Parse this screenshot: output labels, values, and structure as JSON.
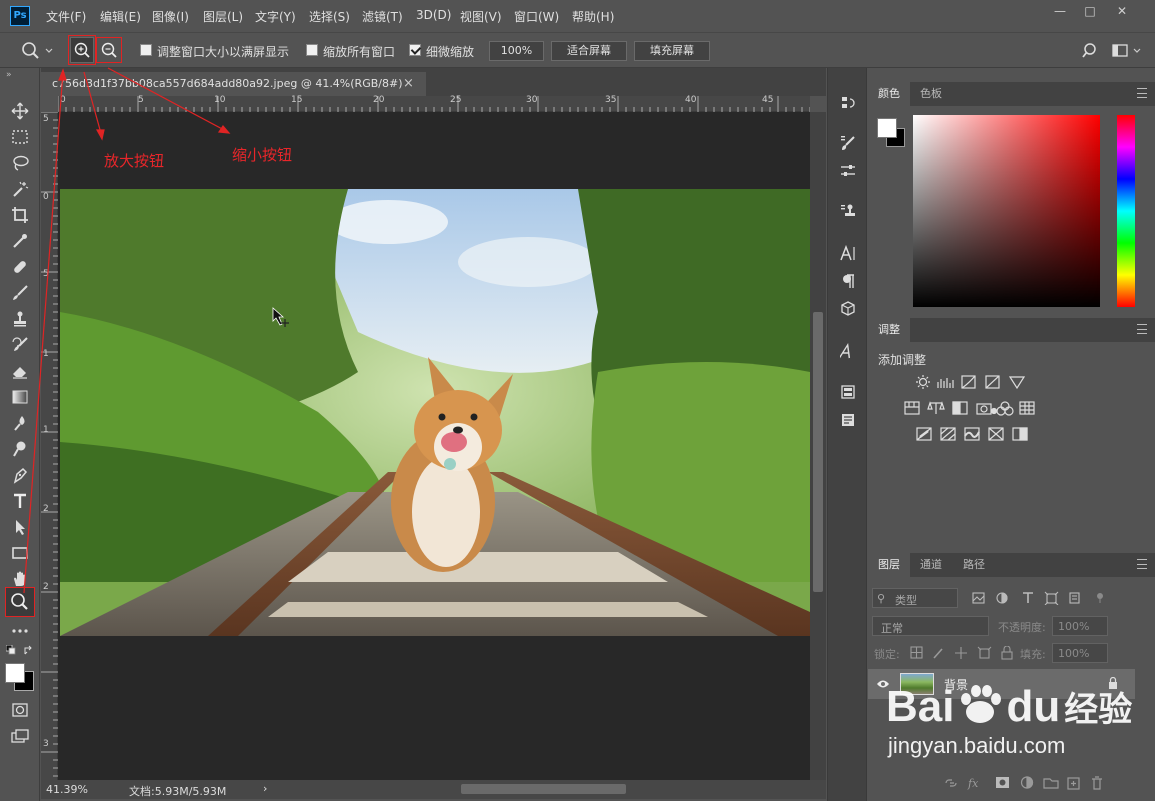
{
  "app": {
    "logo": "Ps"
  },
  "menu": {
    "items": [
      "文件(F)",
      "编辑(E)",
      "图像(I)",
      "图层(L)",
      "文字(Y)",
      "选择(S)",
      "滤镜(T)",
      "3D(D)",
      "视图(V)",
      "窗口(W)",
      "帮助(H)"
    ]
  },
  "window_controls": {
    "minimize": "—",
    "restore": "□",
    "close": "✕"
  },
  "options": {
    "resize_windows_label": "调整窗口大小以满屏显示",
    "zoom_all_label": "缩放所有窗口",
    "scrubby_zoom_label": "细微缩放",
    "zoom_percent": "100%",
    "fit_screen": "适合屏幕",
    "fill_screen": "填充屏幕",
    "resize_windows_checked": false,
    "zoom_all_checked": false,
    "scrubby_zoom_checked": true
  },
  "document": {
    "tab_title": "c756d3d1f37bb08ca557d684add80a92.jpeg @ 41.4%(RGB/8#)",
    "tab_close": "×",
    "ruler_h": [
      "0",
      "5",
      "10",
      "15",
      "20",
      "25",
      "30",
      "35",
      "40",
      "45"
    ],
    "ruler_v": [
      "5",
      "0",
      "5",
      "1",
      "1",
      "2",
      "2",
      "3"
    ]
  },
  "status": {
    "zoom": "41.39%",
    "doc_info": "文档:5.93M/5.93M",
    "arrow": "›"
  },
  "annotations": {
    "zoom_in": "放大按钮",
    "zoom_out": "缩小按钮"
  },
  "color_panel": {
    "tabs": [
      "颜色",
      "色板"
    ],
    "foreground": "#ffffff",
    "background": "#000000"
  },
  "adjustments_panel": {
    "tab": "调整",
    "heading": "添加调整"
  },
  "layers_panel": {
    "tabs": [
      "图层",
      "通道",
      "路径"
    ],
    "filter_kind": "类型",
    "blend_mode": "正常",
    "opacity_label": "不透明度:",
    "opacity_value": "100%",
    "lock_label": "锁定:",
    "fill_label": "填充:",
    "fill_value": "100%",
    "layers": [
      {
        "name": "背景",
        "visible": true,
        "locked": true
      }
    ]
  },
  "watermark": {
    "brand": "Bai",
    "brand2": "du",
    "suffix": "经验",
    "url": "jingyan.baidu.com"
  }
}
